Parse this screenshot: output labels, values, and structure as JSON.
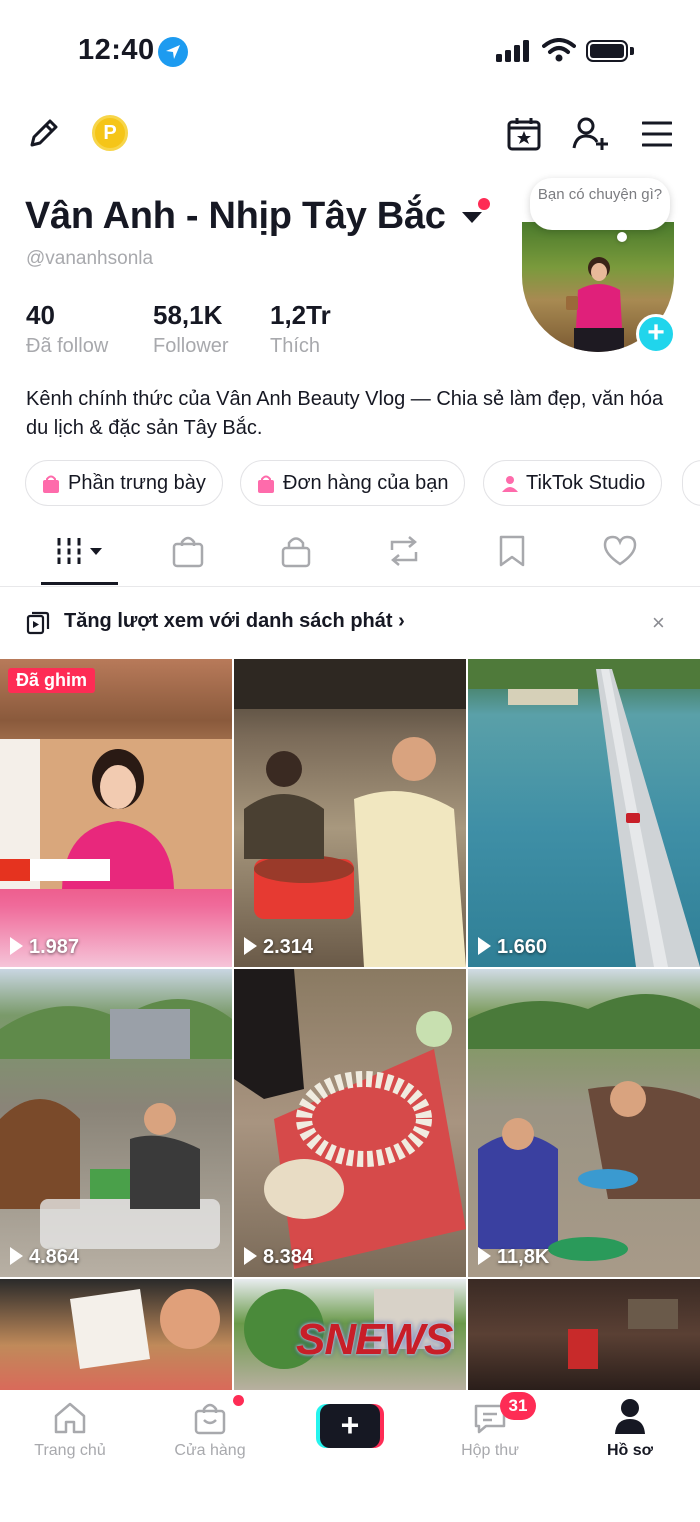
{
  "status_bar": {
    "time": "12:40"
  },
  "profile": {
    "display_name": "Vân Anh - Nhịp Tây Bắc",
    "handle": "@vananhsonla",
    "stats": [
      {
        "value": "40",
        "label": "Đã follow"
      },
      {
        "value": "58,1K",
        "label": "Follower"
      },
      {
        "value": "1,2Tr",
        "label": "Thích"
      }
    ],
    "status_bubble": "Bạn có chuyện gì?",
    "bio": "Kênh chính thức của Vân Anh Beauty Vlog — Chia sẻ làm đẹp, văn hóa du lịch & đặc sản Tây Bắc.",
    "coin_letter": "P"
  },
  "quick_links": [
    {
      "label": "Phần trưng bày"
    },
    {
      "label": "Đơn hàng của bạn"
    },
    {
      "label": "TikTok Studio"
    }
  ],
  "playlist_banner": {
    "text": "Tăng lượt xem với danh sách phát",
    "chevron": "›",
    "close": "×"
  },
  "videos": [
    {
      "views": "1.987",
      "pinned_label": "Đã ghim"
    },
    {
      "views": "2.314"
    },
    {
      "views": "1.660"
    },
    {
      "views": "4.864"
    },
    {
      "views": "8.384"
    },
    {
      "views": "11,8K"
    },
    {
      "views": ""
    },
    {
      "views": ""
    },
    {
      "views": ""
    }
  ],
  "watermark": "SNEWS",
  "bottom_nav": {
    "items": [
      {
        "label": "Trang chủ"
      },
      {
        "label": "Cửa hàng"
      },
      {
        "label": "Hộp thư",
        "badge": "31"
      },
      {
        "label": "Hồ sơ"
      }
    ],
    "create_symbol": "+"
  },
  "colors": {
    "accent": "#fe2c55",
    "cyan": "#25f4ee",
    "text": "#161823",
    "muted": "#a8a9ad"
  },
  "icons": [
    "location-arrow-icon",
    "signal-icon",
    "wifi-icon",
    "battery-icon",
    "pencil-icon",
    "coin-icon",
    "calendar-star-icon",
    "add-friend-icon",
    "menu-icon"
  ]
}
